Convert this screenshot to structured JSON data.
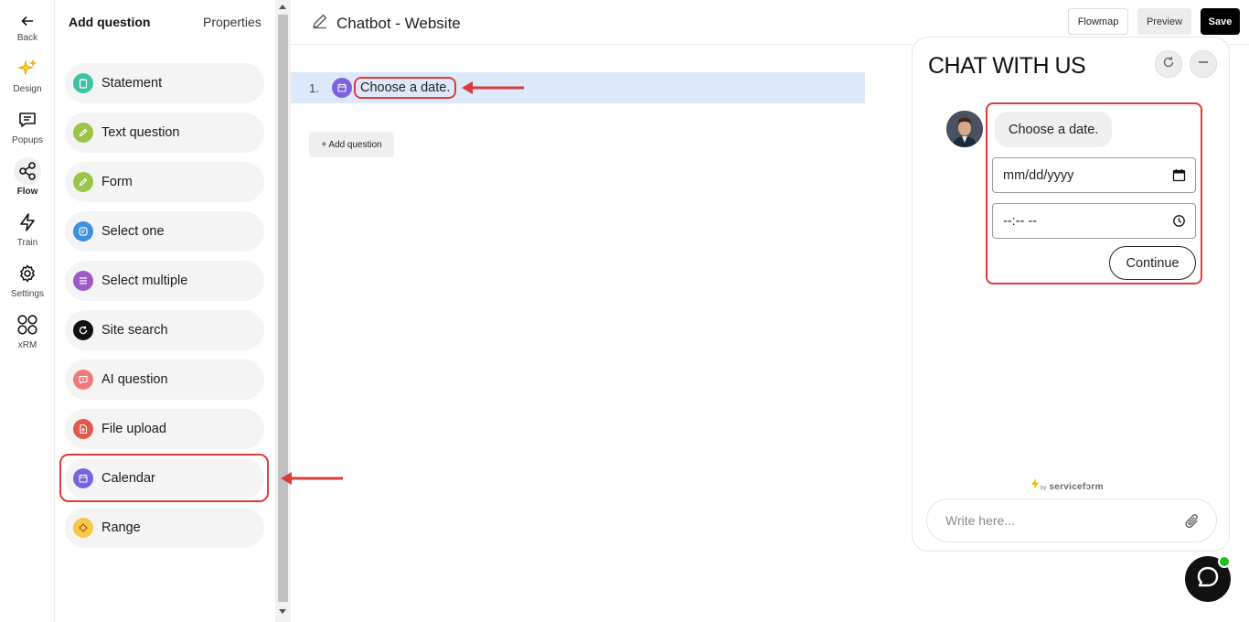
{
  "rail": {
    "back": "Back",
    "items": [
      {
        "label": "Design",
        "icon": "sparkle-icon"
      },
      {
        "label": "Popups",
        "icon": "message-icon"
      },
      {
        "label": "Flow",
        "icon": "share-nodes-icon",
        "active": true
      },
      {
        "label": "Train",
        "icon": "lightning-icon"
      },
      {
        "label": "Settings",
        "icon": "gear-icon"
      },
      {
        "label": "xRM",
        "icon": "grid-icon"
      }
    ]
  },
  "panel": {
    "tab_active": "Add question",
    "tab_inactive": "Properties",
    "items": [
      {
        "label": "Statement",
        "color": "#3cc2a4"
      },
      {
        "label": "Text question",
        "color": "#9cc34a"
      },
      {
        "label": "Form",
        "color": "#9cc34a"
      },
      {
        "label": "Select one",
        "color": "#3d8fe0"
      },
      {
        "label": "Select multiple",
        "color": "#9c5ac6"
      },
      {
        "label": "Site search",
        "color": "#111111"
      },
      {
        "label": "AI question",
        "color": "#f07a7a"
      },
      {
        "label": "File upload",
        "color": "#e35a4a"
      },
      {
        "label": "Calendar",
        "color": "#7a62e0"
      },
      {
        "label": "Range",
        "color": "#f7c64a"
      }
    ]
  },
  "header": {
    "title": "Chatbot - Website",
    "flowmap": "Flowmap",
    "preview": "Preview",
    "save": "Save"
  },
  "canvas": {
    "question_number": "1.",
    "question_text": "Choose a date.",
    "add_question": "+ Add question"
  },
  "chat": {
    "title": "CHAT WITH US",
    "bot_message": "Choose a date.",
    "date_placeholder": "mm/dd/yyyy",
    "time_placeholder": "--:-- --",
    "continue": "Continue",
    "powered_by": "by",
    "brand": "servicefɔrm",
    "composer_placeholder": "Write here..."
  },
  "colors": {
    "accent_red": "#e03a3a",
    "row_highlight": "#dde9fb",
    "online": "#1ec31e"
  }
}
